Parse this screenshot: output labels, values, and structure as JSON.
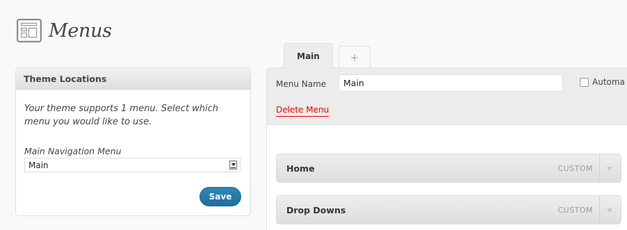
{
  "page": {
    "title": "Menus"
  },
  "theme_locations": {
    "title": "Theme Locations",
    "description": "Your theme supports 1 menu. Select which menu you would like to use.",
    "location_label": "Main Navigation Menu",
    "selected_menu": "Main",
    "save_label": "Save"
  },
  "tabs": [
    {
      "label": "Main",
      "active": true
    },
    {
      "label": "+",
      "active": false
    }
  ],
  "editor": {
    "menu_name_label": "Menu Name",
    "menu_name_value": "Main",
    "auto_add_label": "Automa",
    "delete_label": "Delete Menu"
  },
  "menu_items": [
    {
      "title": "Home",
      "type": "CUSTOM"
    },
    {
      "title": "Drop Downs",
      "type": "CUSTOM"
    }
  ],
  "colors": {
    "accent_button": "#21759b",
    "delete_link": "#ee0000"
  }
}
